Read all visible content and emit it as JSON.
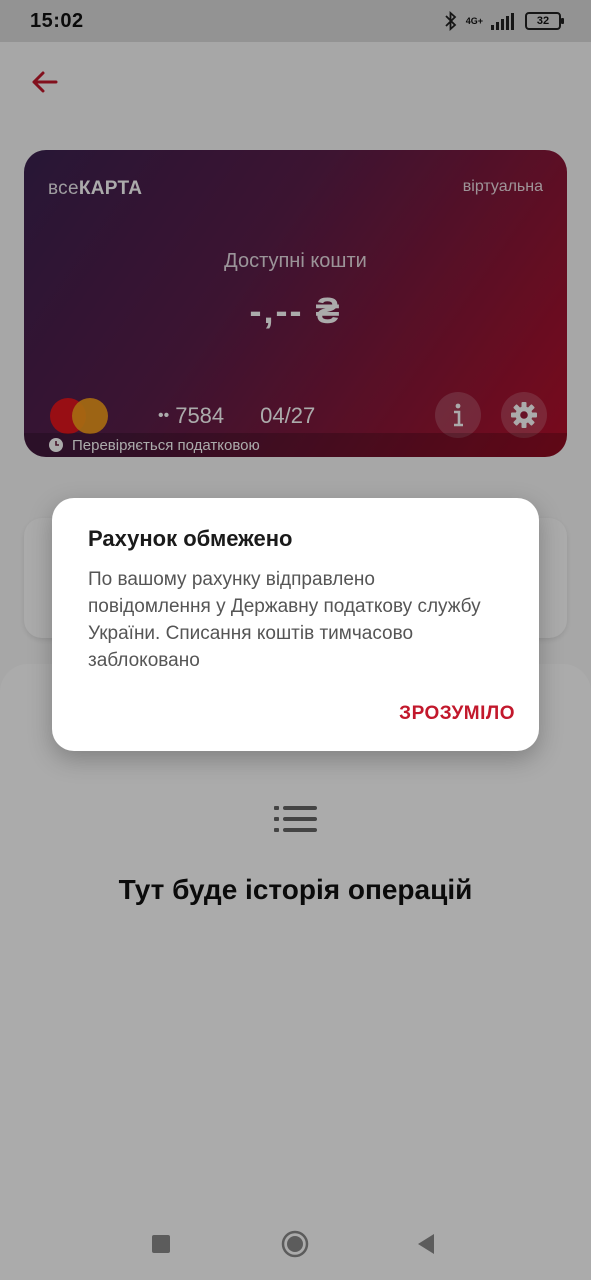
{
  "status_bar": {
    "time": "15:02",
    "network": "4G+",
    "battery": "32",
    "icons": [
      "bluetooth-icon",
      "signal-icon",
      "battery-icon"
    ]
  },
  "header": {
    "back_icon": "arrow-left-icon",
    "accent_color": "#c2182c"
  },
  "card": {
    "brand_light": "все",
    "brand_bold": "КАРТА",
    "type": "віртуальна",
    "available_label": "Доступні кошти",
    "balance": "-,-- ₴",
    "number_dots": "••",
    "number_last4": "7584",
    "expiry": "04/27",
    "network_logo": "mastercard-logo",
    "status_text": "Перевіряється податковою",
    "gradient_colors": [
      "#3b2150",
      "#b50f2a"
    ]
  },
  "history": {
    "icon": "list-icon",
    "empty_text": "Тут буде історія операцій"
  },
  "dialog": {
    "title": "Рахунок обмежено",
    "body": "По вашому рахунку відправлено повідомлення у Державну податкову службу України. Списання коштів тимчасово заблоковано",
    "button": "ЗРОЗУМІЛО"
  },
  "nav": {
    "icons": [
      "square-icon",
      "circle-icon",
      "triangle-back-icon"
    ]
  }
}
